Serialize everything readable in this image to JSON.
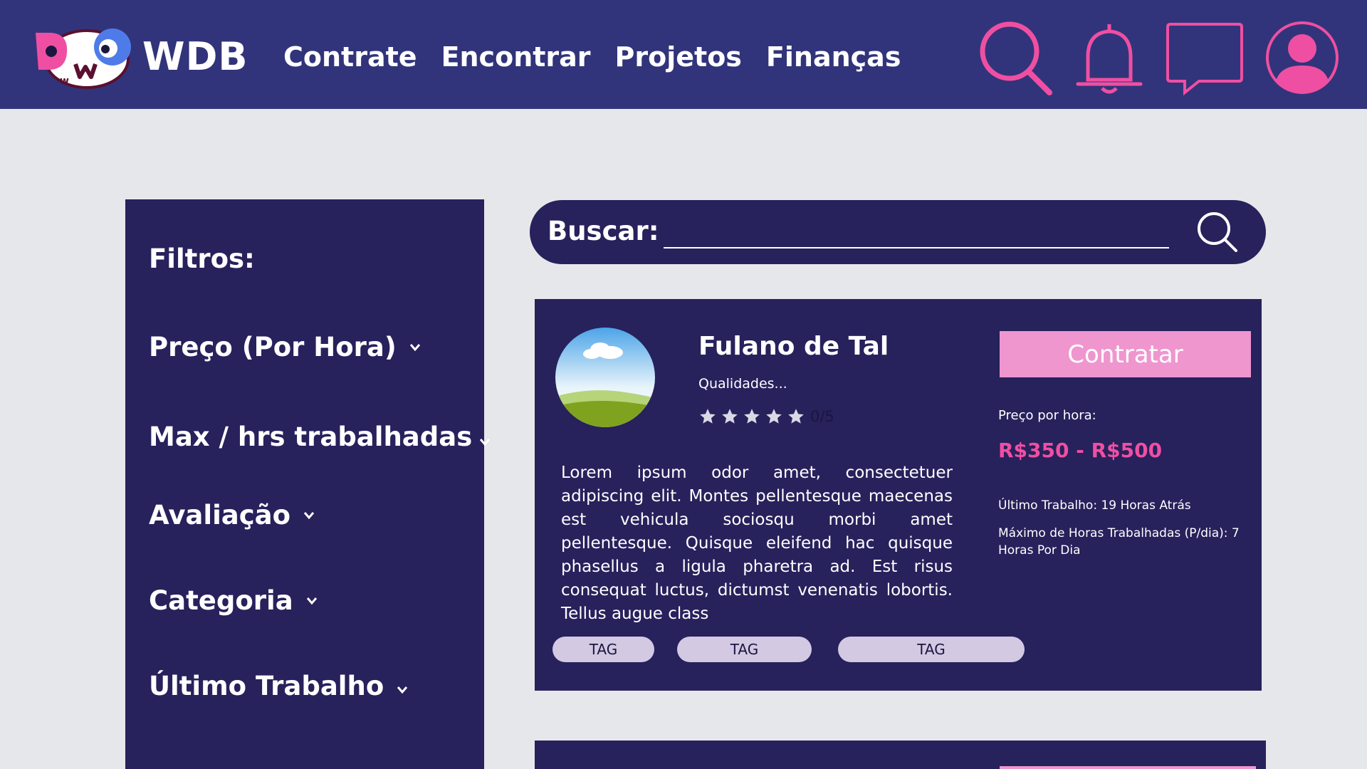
{
  "header": {
    "brand": "WDB",
    "nav": [
      "Contrate",
      "Encontrar",
      "Projetos",
      "Finanças"
    ],
    "icons": [
      "search-icon",
      "bell-icon",
      "chat-icon",
      "user-profile-icon"
    ],
    "accent": "#ef4fa2",
    "background": "#31347a"
  },
  "sidebar": {
    "title": "Filtros:",
    "filters": [
      "Preço (Por Hora)",
      "Max / hrs trabalhadas",
      "Avaliação",
      "Categoria",
      "Último Trabalho"
    ]
  },
  "search": {
    "label": "Buscar:",
    "value": ""
  },
  "card": {
    "name": "Fulano de Tal",
    "qualities": "Qualidades...",
    "rating": {
      "stars": 5,
      "value": "0/5"
    },
    "description": "Lorem ipsum odor amet, consectetuer adipiscing elit. Montes pellentesque maecenas est vehicula sociosqu morbi amet pellentesque. Quisque eleifend hac quisque phasellus a ligula pharetra ad. Est risus consequat luctus, dictumst venenatis lobortis. Tellus augue class",
    "hire_label": "Contratar",
    "price_label": "Preço por hora:",
    "price_value": "R$350 - R$500",
    "last_work": "Último Trabalho: 19 Horas Atrás",
    "max_hours": "Máximo de Horas Trabalhadas (P/dia): 7 Horas Por Dia",
    "tags": [
      "TAG",
      "TAG",
      "TAG"
    ]
  },
  "colors": {
    "page_bg": "#e6e7eb",
    "panel": "#27215c",
    "button": "#ef96cf",
    "tag": "#d4c9e3"
  }
}
